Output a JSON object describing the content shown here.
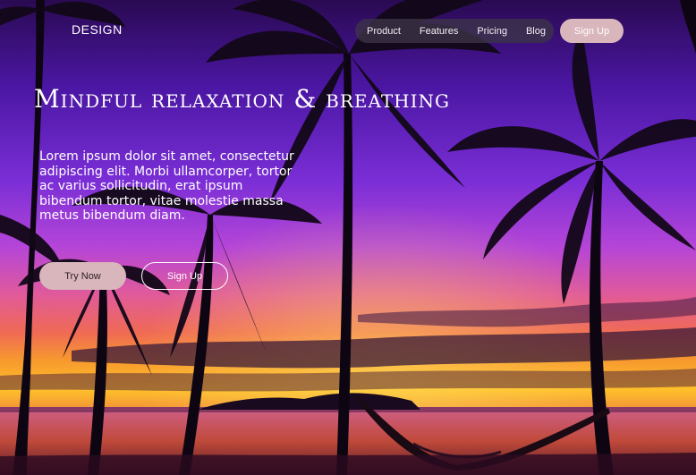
{
  "header": {
    "brand": "DESIGN",
    "nav": [
      "Product",
      "Features",
      "Pricing",
      "Blog"
    ],
    "signup_label": "Sign Up"
  },
  "hero": {
    "title": "Mindful relaxation & breathing",
    "body": "Lorem ipsum dolor sit amet, consectetur adipiscing elit. Morbi ullamcorper, tortor ac varius sollicitudin, erat ipsum bibendum tortor, vitae molestie massa metus bibendum diam.",
    "primary_button": "Try Now",
    "secondary_button": "Sign Up"
  },
  "colors": {
    "accent_pill": "#d9b6bc",
    "nav_background": "#3c3448",
    "text": "#ffffff"
  }
}
